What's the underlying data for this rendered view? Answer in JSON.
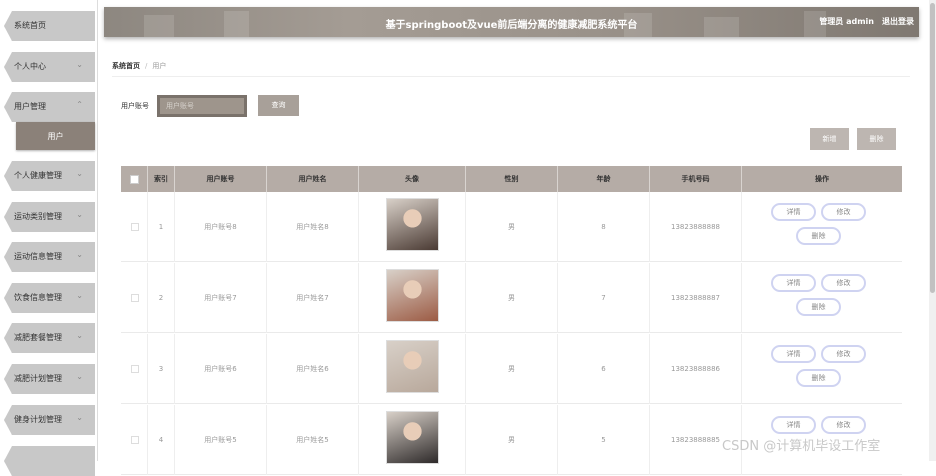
{
  "header": {
    "title": "基于springboot及vue前后端分离的健康减肥系统平台",
    "user": "管理员 admin",
    "logout": "退出登录"
  },
  "sidebar": {
    "items": [
      {
        "label": "系统首页",
        "chev": ""
      },
      {
        "label": "个人中心",
        "chev": "⌄"
      },
      {
        "label": "用户管理",
        "chev": "⌃"
      },
      {
        "label": "个人健康管理",
        "chev": "⌄"
      },
      {
        "label": "运动类别管理",
        "chev": "⌄"
      },
      {
        "label": "运动信息管理",
        "chev": "⌄"
      },
      {
        "label": "饮食信息管理",
        "chev": "⌄"
      },
      {
        "label": "减肥套餐管理",
        "chev": "⌄"
      },
      {
        "label": "减肥计划管理",
        "chev": "⌄"
      },
      {
        "label": "健身计划管理",
        "chev": "⌄"
      }
    ],
    "sub_item": "用户"
  },
  "breadcrumb": {
    "home": "系统首页",
    "sep": "/",
    "current": "用户"
  },
  "search": {
    "label": "用户账号",
    "placeholder": "用户账号",
    "button": "查询"
  },
  "actions": {
    "add": "新增",
    "delete": "删除"
  },
  "table": {
    "headers": [
      "索引",
      "用户账号",
      "用户姓名",
      "头像",
      "性别",
      "年龄",
      "手机号码",
      "操作"
    ],
    "rows": [
      {
        "index": "1",
        "account": "用户账号8",
        "name": "用户姓名8",
        "gender": "男",
        "age": "8",
        "phone": "13823888888",
        "avatar_color": "#4a3a33"
      },
      {
        "index": "2",
        "account": "用户账号7",
        "name": "用户姓名7",
        "gender": "男",
        "age": "7",
        "phone": "13823888887",
        "avatar_color": "#9c5b44"
      },
      {
        "index": "3",
        "account": "用户账号6",
        "name": "用户姓名6",
        "gender": "男",
        "age": "6",
        "phone": "13823888886",
        "avatar_color": "#b8a89b"
      },
      {
        "index": "4",
        "account": "用户账号5",
        "name": "用户姓名5",
        "gender": "男",
        "age": "5",
        "phone": "13823888885",
        "avatar_color": "#2e2a2a"
      }
    ],
    "row_actions": {
      "detail": "详情",
      "edit": "修改",
      "delete": "删除"
    }
  },
  "watermark": "CSDN @计算机毕设工作室"
}
